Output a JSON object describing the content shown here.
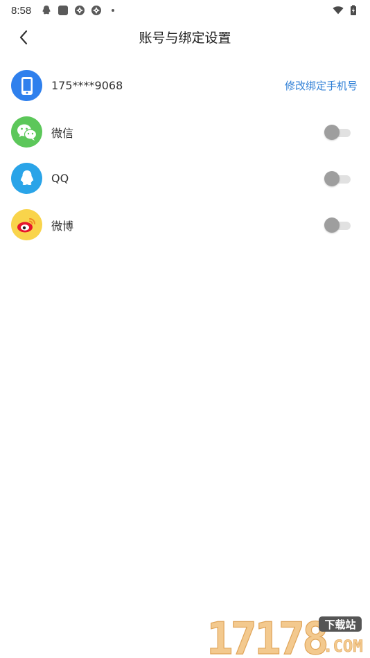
{
  "status_bar": {
    "time": "8:58",
    "left_icons": [
      "qq-notification-icon",
      "app-notification-icon",
      "aperture-icon",
      "aperture-icon",
      "dot-icon"
    ],
    "right_icons": [
      "wifi-icon",
      "battery-charging-icon"
    ]
  },
  "header": {
    "title": "账号与绑定设置",
    "back_icon": "chevron-left-icon"
  },
  "accounts": [
    {
      "id": "phone",
      "label": "175****9068",
      "icon": "phone-icon",
      "color": "#2f80ed",
      "action": "修改绑定手机号"
    },
    {
      "id": "wechat",
      "label": "微信",
      "icon": "wechat-icon",
      "color": "#5cc75a",
      "bound": false
    },
    {
      "id": "qq",
      "label": "QQ",
      "icon": "qq-icon",
      "color": "#2aa4e8",
      "bound": false
    },
    {
      "id": "weibo",
      "label": "微博",
      "icon": "weibo-icon",
      "color": "#f9d44b",
      "bound": false
    }
  ],
  "watermark": {
    "number": "17178",
    "tag": "下载站",
    "domain": ".COM"
  }
}
